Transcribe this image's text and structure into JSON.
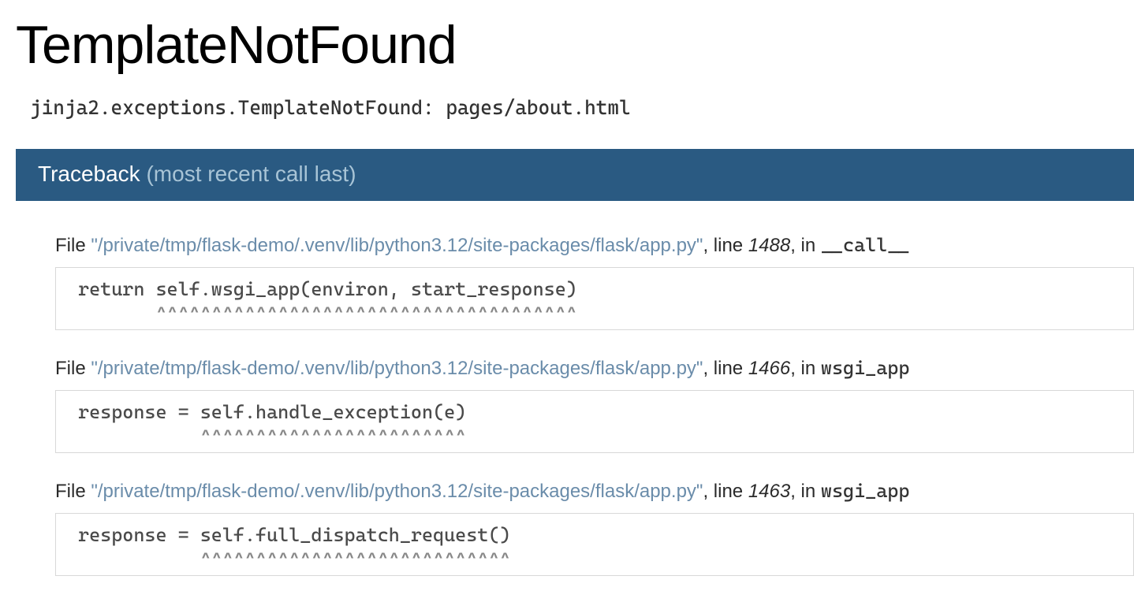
{
  "error_title": "TemplateNotFound",
  "exception_text": "jinja2.exceptions.TemplateNotFound: pages/about.html",
  "traceback_header": {
    "title": "Traceback",
    "subtitle": "(most recent call last)"
  },
  "frames": [
    {
      "file_prefix": "File ",
      "file_path": "\"/private/tmp/flask-demo/.venv/lib/python3.12/site-packages/flask/app.py\"",
      "line_prefix": ", line ",
      "line_num": "1488",
      "in_prefix": ", in ",
      "func_name": "__call__",
      "code": "return self.wsgi_app(environ, start_response)",
      "carets": "       ^^^^^^^^^^^^^^^^^^^^^^^^^^^^^^^^^^^^^^"
    },
    {
      "file_prefix": "File ",
      "file_path": "\"/private/tmp/flask-demo/.venv/lib/python3.12/site-packages/flask/app.py\"",
      "line_prefix": ", line ",
      "line_num": "1466",
      "in_prefix": ", in ",
      "func_name": "wsgi_app",
      "code": "response = self.handle_exception(e)",
      "carets": "           ^^^^^^^^^^^^^^^^^^^^^^^^"
    },
    {
      "file_prefix": "File ",
      "file_path": "\"/private/tmp/flask-demo/.venv/lib/python3.12/site-packages/flask/app.py\"",
      "line_prefix": ", line ",
      "line_num": "1463",
      "in_prefix": ", in ",
      "func_name": "wsgi_app",
      "code": "response = self.full_dispatch_request()",
      "carets": "           ^^^^^^^^^^^^^^^^^^^^^^^^^^^^"
    }
  ]
}
